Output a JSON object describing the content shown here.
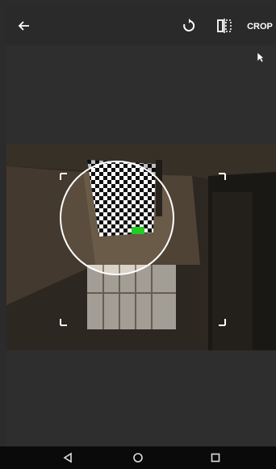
{
  "app_bar": {
    "back_icon": "arrow-left-icon",
    "rotate_icon": "rotate-icon",
    "flip_icon": "flip-horizontal-icon",
    "crop_label": "CROP"
  },
  "nav_bar": {
    "back_icon": "triangle-back-icon",
    "home_icon": "circle-home-icon",
    "recents_icon": "square-recents-icon"
  },
  "colors": {
    "background": "#2b2b2b",
    "appbar": "#2a2a2a",
    "nav": "#0a0a0a",
    "selection_highlight": "#22cc22"
  }
}
